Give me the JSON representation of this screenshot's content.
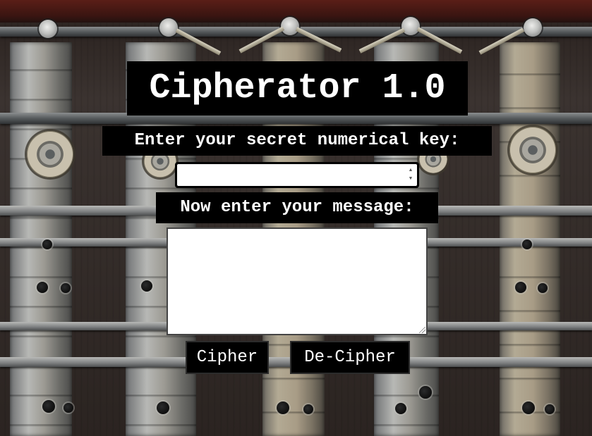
{
  "app": {
    "title": "Cipherator 1.0"
  },
  "key_section": {
    "label": "Enter your secret numerical key:",
    "value": "",
    "placeholder": ""
  },
  "message_section": {
    "label": "Now enter your message:",
    "value": "",
    "placeholder": ""
  },
  "actions": {
    "cipher_label": "Cipher",
    "decipher_label": "De-Cipher"
  },
  "icons": {
    "spinner_up": "spinner-up-icon",
    "spinner_down": "spinner-down-icon",
    "resize": "resize-grip-icon"
  },
  "colors": {
    "label_background": "#000000",
    "label_text": "#ffffff",
    "field_background": "#ffffff"
  }
}
